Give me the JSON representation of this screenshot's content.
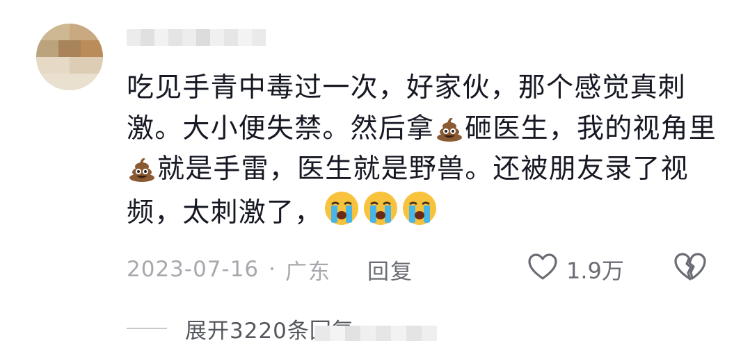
{
  "comment": {
    "text_segments": [
      {
        "type": "text",
        "value": "吃见手青中毒过一次，好家伙，那个感觉真刺激。大小便失禁。然后拿"
      },
      {
        "type": "emoji",
        "icon": "poop-emoji"
      },
      {
        "type": "text",
        "value": "砸医生，我的视角里"
      },
      {
        "type": "emoji",
        "icon": "poop-emoji"
      },
      {
        "type": "text",
        "value": "就是手雷，医生就是野兽。还被朋友录了视频，太刺激了，"
      },
      {
        "type": "emoji",
        "icon": "crying-face-emoji"
      },
      {
        "type": "emoji",
        "icon": "crying-face-emoji"
      },
      {
        "type": "emoji",
        "icon": "crying-face-emoji"
      }
    ],
    "text_1": "吃见手青中毒过一次，好家伙，那个感觉真刺激。大小便失禁。然后拿",
    "text_2": "砸医生，我的视角里",
    "text_3": "就是手雷，医生就是野兽。还被朋友录了视频，太刺激了，",
    "date": "2023-07-16",
    "separator": "·",
    "location": "广东",
    "reply_label": "回复",
    "like_count": "1.9万"
  },
  "replies": {
    "expand_label": "展开3220条回复"
  },
  "icons": {
    "like": "heart-outline-icon",
    "dislike": "broken-heart-icon",
    "poop": "poop-emoji",
    "cry": "crying-face-emoji"
  },
  "colors": {
    "text_primary": "#161823",
    "text_meta": "#a7a8ad",
    "text_secondary": "#6a6c73",
    "background": "#ffffff"
  }
}
